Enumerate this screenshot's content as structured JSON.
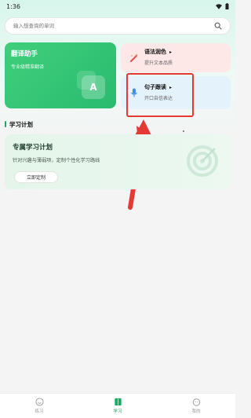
{
  "status_bar": {
    "time": "1:36"
  },
  "search": {
    "placeholder": "输入想查询的单词"
  },
  "cards": {
    "translate": {
      "title": "翻译助手",
      "subtitle": "专业级精准翻译",
      "badge": "A"
    },
    "grammar": {
      "title": "语法润色",
      "subtitle": "提升文本品质",
      "arrow": "▸"
    },
    "sentence": {
      "title": "句子跟读",
      "subtitle": "开口自信表达",
      "arrow": "▸"
    }
  },
  "section": {
    "title": "学习计划"
  },
  "plan": {
    "title": "专属学习计划",
    "subtitle": "针对兴趣与薄弱项，定制个性化学习路线",
    "button_label": "立即定制"
  },
  "tabs": [
    {
      "label": "练习",
      "icon": "smile-icon",
      "active": false
    },
    {
      "label": "学习",
      "icon": "book-icon",
      "active": true
    },
    {
      "label": "我的",
      "icon": "face-icon",
      "active": false
    }
  ],
  "colors": {
    "accent": "#1ba863",
    "translate_card": "#34c674",
    "grammar_card": "#fde8e7",
    "sentence_card": "#e4f3fb",
    "highlight": "#e53935"
  }
}
